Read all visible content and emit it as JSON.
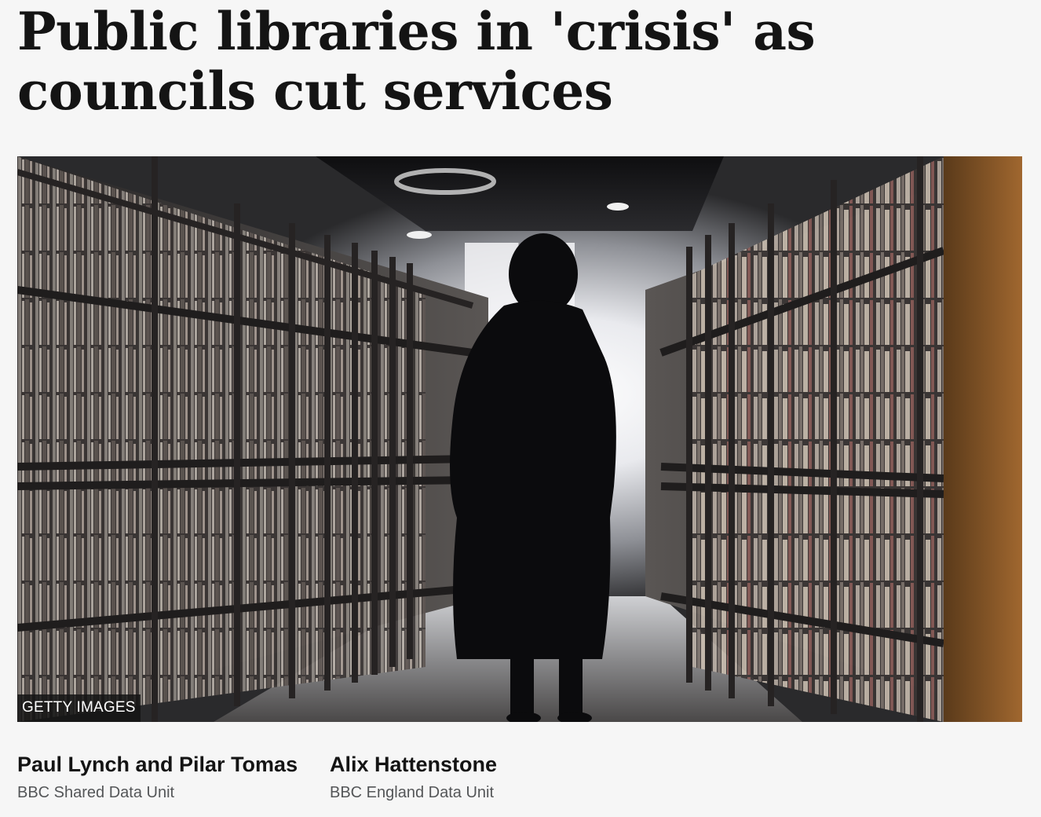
{
  "article": {
    "headline": "Public libraries in 'crisis' as councils cut services",
    "image_credit": "GETTY IMAGES",
    "authors": [
      {
        "name": "Paul Lynch and Pilar Tomas",
        "unit": "BBC Shared Data Unit"
      },
      {
        "name": "Alix Hattenstone",
        "unit": "BBC England Data Unit"
      }
    ]
  },
  "colors": {
    "page_background": "#f6f6f6",
    "headline_text": "#141414",
    "byline_unit_text": "#545658",
    "credit_background": "#141414"
  }
}
